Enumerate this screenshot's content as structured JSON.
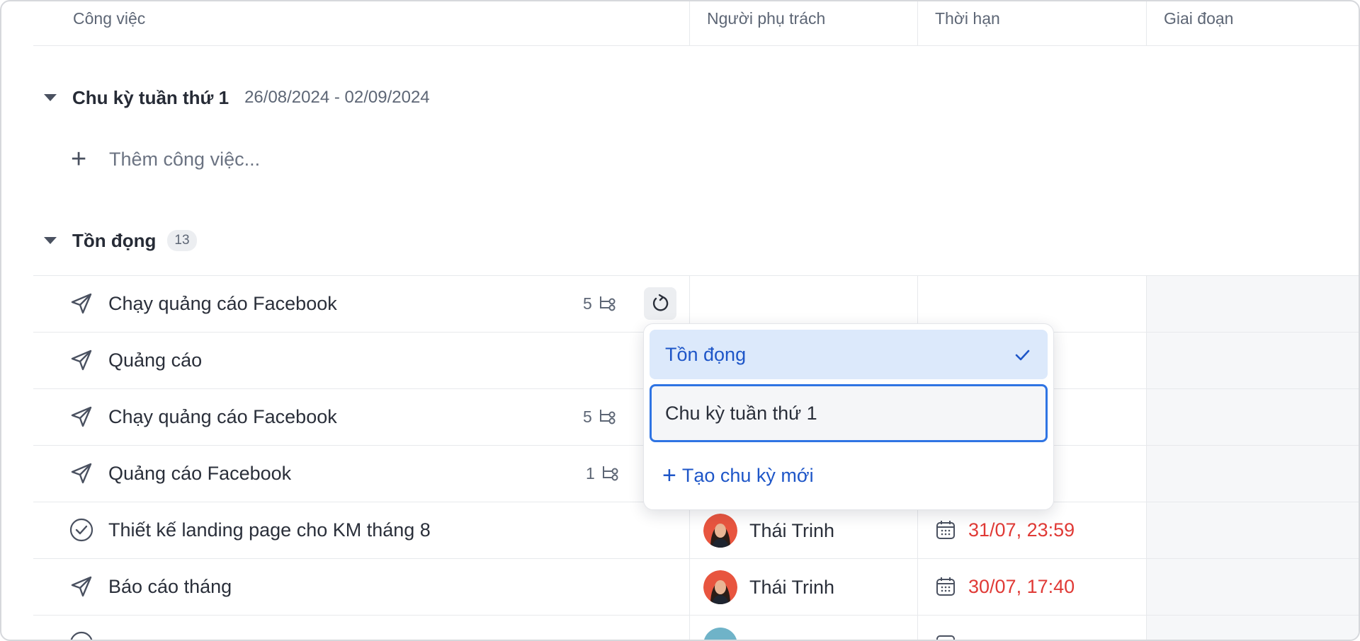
{
  "columns": {
    "task": "Công việc",
    "assignee": "Người phụ trách",
    "deadline": "Thời hạn",
    "phase": "Giai đoạn"
  },
  "groups": [
    {
      "title": "Chu kỳ tuần thứ 1",
      "range": "26/08/2024 - 02/09/2024",
      "add_task": "Thêm công việc..."
    },
    {
      "title": "Tồn đọng",
      "count": "13"
    }
  ],
  "tasks": [
    {
      "name": "Chạy quảng cáo Facebook",
      "subtasks": "5",
      "icon": "send-icon"
    },
    {
      "name": "Quảng cáo",
      "icon": "send-icon"
    },
    {
      "name": "Chạy quảng cáo Facebook",
      "subtasks": "5",
      "icon": "send-icon"
    },
    {
      "name": "Quảng cáo Facebook",
      "subtasks": "1",
      "icon": "send-icon"
    },
    {
      "name": "Thiết kế landing page cho KM tháng 8",
      "icon": "check-circle-icon",
      "assignee": "Thái Trinh",
      "due": "31/07, 23:59"
    },
    {
      "name": "Báo cáo tháng",
      "icon": "send-icon",
      "assignee": "Thái Trinh",
      "due": "30/07, 17:40"
    }
  ],
  "cycle_menu": {
    "options": [
      "Tồn đọng",
      "Chu kỳ tuần thứ 1"
    ],
    "selected": "Tồn đọng",
    "create_label": "Tạo chu kỳ mới"
  },
  "colors": {
    "accent": "#1e56c8",
    "overdue": "#e03a36",
    "focus_border": "#2f74e3"
  }
}
